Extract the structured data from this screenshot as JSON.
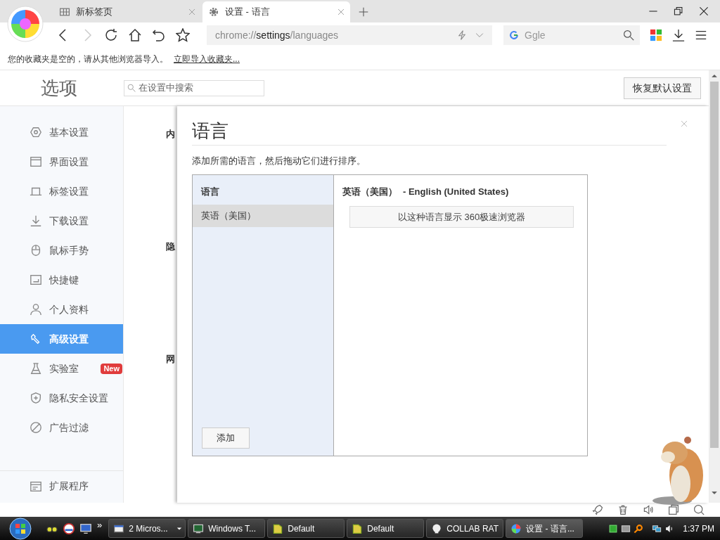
{
  "tabs": [
    {
      "label": "新标签页",
      "selected": false
    },
    {
      "label": "设置 - 语言",
      "selected": true
    }
  ],
  "address": {
    "prefix": "chrome://",
    "host": "settings",
    "path": "/languages"
  },
  "search": {
    "placeholder": "Ggle"
  },
  "bookmarks_bar": {
    "message": "您的收藏夹是空的，请从其他浏览器导入。",
    "link": "立即导入收藏夹..."
  },
  "settings": {
    "title": "选项",
    "search_placeholder": "在设置中搜索",
    "restore_button": "恢复默认设置"
  },
  "sidebar": {
    "items": [
      {
        "label": "基本设置",
        "selected": false
      },
      {
        "label": "界面设置",
        "selected": false
      },
      {
        "label": "标签设置",
        "selected": false
      },
      {
        "label": "下载设置",
        "selected": false
      },
      {
        "label": "鼠标手势",
        "selected": false
      },
      {
        "label": "快捷键",
        "selected": false
      },
      {
        "label": "个人资料",
        "selected": false
      },
      {
        "label": "高级设置",
        "selected": true
      },
      {
        "label": "实验室",
        "selected": false,
        "badge": "New"
      },
      {
        "label": "隐私安全设置",
        "selected": false
      },
      {
        "label": "广告过滤",
        "selected": false
      }
    ],
    "footer": {
      "label": "扩展程序"
    }
  },
  "content_headings": [
    "内",
    "隐",
    "网"
  ],
  "dialog": {
    "title": "语言",
    "description": "添加所需的语言，然后拖动它们进行排序。",
    "list_header": "语言",
    "languages": [
      {
        "label": "英语（美国）",
        "selected": true
      }
    ],
    "add_button": "添加",
    "detail_title": "英语（美国）",
    "detail_native": "- English (United States)",
    "display_button": "以这种语言显示 360极速浏览器"
  },
  "taskbar": {
    "overflow": "»",
    "tasks": [
      {
        "label": "2 Micros...",
        "dropdown": true
      },
      {
        "label": "Windows T...",
        "dropdown": false
      },
      {
        "label": "Default",
        "dropdown": false
      },
      {
        "label": "Default",
        "dropdown": false
      },
      {
        "label": "COLLAB RAT",
        "dropdown": false
      },
      {
        "label": "设置 - 语言...",
        "dropdown": false
      }
    ],
    "clock": "1:37 PM"
  }
}
